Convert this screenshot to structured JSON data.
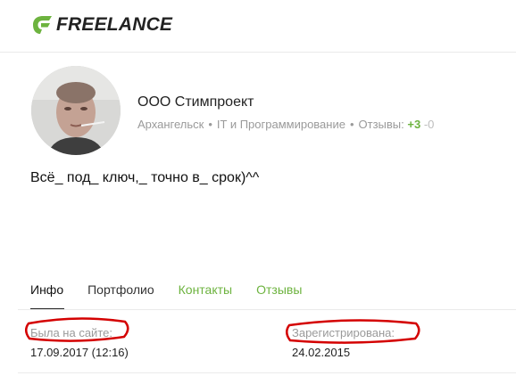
{
  "header": {
    "logo_text": "FREELANCE",
    "logo_icon": "freelance-logo-mark",
    "brand_color": "#6db33f"
  },
  "profile": {
    "name": "ООО Стимпроект",
    "city": "Архангельск",
    "category": "IT и Программирование",
    "reviews_label": "Отзывы:",
    "reviews_positive": "+3",
    "reviews_negative": "-0",
    "slogan": "Всё_ под_ ключ,_ точно в_ срок)^^"
  },
  "tabs": [
    {
      "label": "Инфо"
    },
    {
      "label": "Портфолио"
    },
    {
      "label": "Контакты"
    },
    {
      "label": "Отзывы"
    }
  ],
  "info": {
    "last_seen_label": "Была на сайте:",
    "last_seen_value": "17.09.2017 (12:16)",
    "registered_label": "Зарегистрирована:",
    "registered_value": "24.02.2015"
  },
  "annotation_color": "#d40000"
}
